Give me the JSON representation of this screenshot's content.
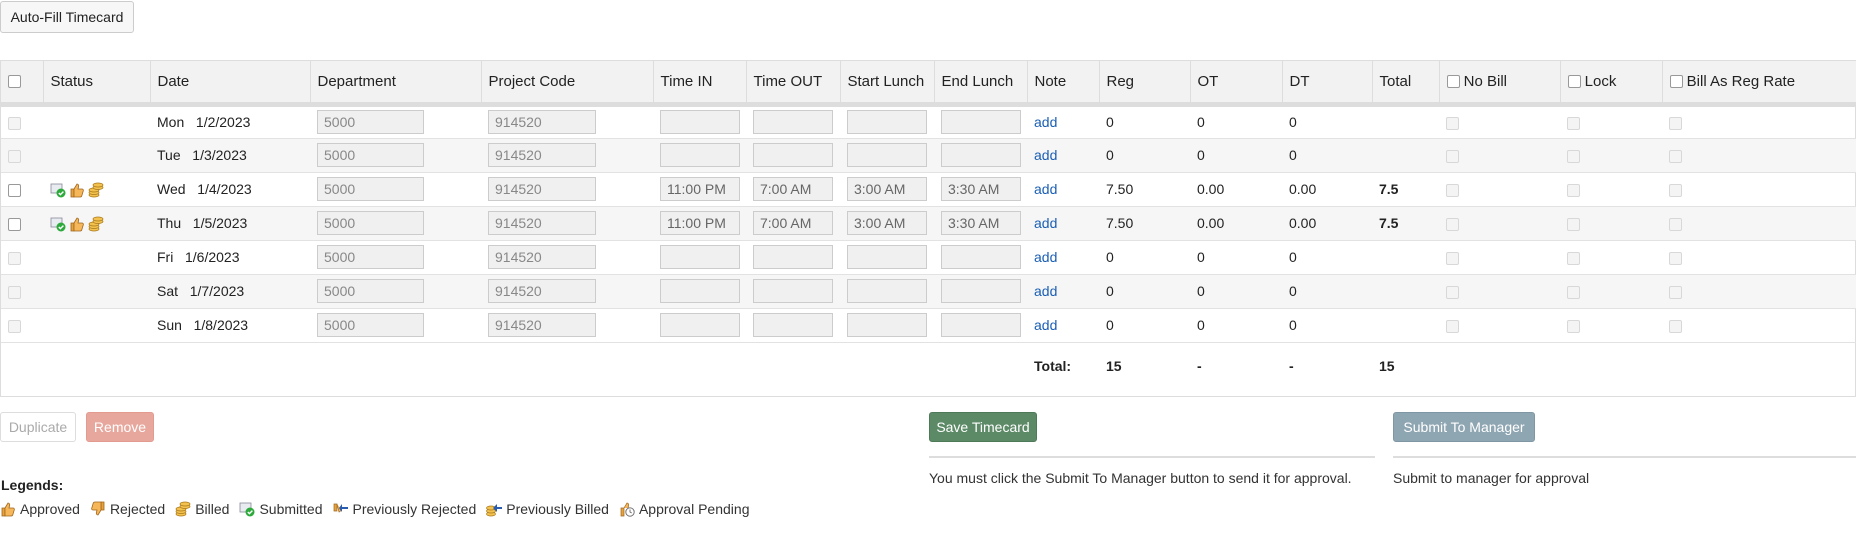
{
  "toolbar": {
    "autofill_label": "Auto-Fill Timecard"
  },
  "table": {
    "headers": {
      "status": "Status",
      "date": "Date",
      "department": "Department",
      "project_code": "Project Code",
      "time_in": "Time IN",
      "time_out": "Time OUT",
      "start_lunch": "Start Lunch",
      "end_lunch": "End Lunch",
      "note": "Note",
      "reg": "Reg",
      "ot": "OT",
      "dt": "DT",
      "total": "Total",
      "no_bill": "No Bill",
      "lock": "Lock",
      "bill_as_reg": "Bill As Reg Rate"
    },
    "rows": [
      {
        "day": "Mon",
        "date": "1/2/2023",
        "dept": "5000",
        "proj": "914520",
        "time_in": "",
        "time_out": "",
        "start_lunch": "",
        "end_lunch": "",
        "note": "add",
        "reg": "0",
        "ot": "0",
        "dt": "0",
        "total": "",
        "status": false
      },
      {
        "day": "Tue",
        "date": "1/3/2023",
        "dept": "5000",
        "proj": "914520",
        "time_in": "",
        "time_out": "",
        "start_lunch": "",
        "end_lunch": "",
        "note": "add",
        "reg": "0",
        "ot": "0",
        "dt": "0",
        "total": "",
        "status": false
      },
      {
        "day": "Wed",
        "date": "1/4/2023",
        "dept": "5000",
        "proj": "914520",
        "time_in": "11:00 PM",
        "time_out": "7:00 AM",
        "start_lunch": "3:00 AM",
        "end_lunch": "3:30 AM",
        "note": "add",
        "reg": "7.50",
        "ot": "0.00",
        "dt": "0.00",
        "total": "7.5",
        "status": true
      },
      {
        "day": "Thu",
        "date": "1/5/2023",
        "dept": "5000",
        "proj": "914520",
        "time_in": "11:00 PM",
        "time_out": "7:00 AM",
        "start_lunch": "3:00 AM",
        "end_lunch": "3:30 AM",
        "note": "add",
        "reg": "7.50",
        "ot": "0.00",
        "dt": "0.00",
        "total": "7.5",
        "status": true
      },
      {
        "day": "Fri",
        "date": "1/6/2023",
        "dept": "5000",
        "proj": "914520",
        "time_in": "",
        "time_out": "",
        "start_lunch": "",
        "end_lunch": "",
        "note": "add",
        "reg": "0",
        "ot": "0",
        "dt": "0",
        "total": "",
        "status": false
      },
      {
        "day": "Sat",
        "date": "1/7/2023",
        "dept": "5000",
        "proj": "914520",
        "time_in": "",
        "time_out": "",
        "start_lunch": "",
        "end_lunch": "",
        "note": "add",
        "reg": "0",
        "ot": "0",
        "dt": "0",
        "total": "",
        "status": false
      },
      {
        "day": "Sun",
        "date": "1/8/2023",
        "dept": "5000",
        "proj": "914520",
        "time_in": "",
        "time_out": "",
        "start_lunch": "",
        "end_lunch": "",
        "note": "add",
        "reg": "0",
        "ot": "0",
        "dt": "0",
        "total": "",
        "status": false
      }
    ],
    "totals": {
      "label": "Total:",
      "reg": "15",
      "ot": "-",
      "dt": "-",
      "total": "15"
    }
  },
  "actions": {
    "duplicate_label": "Duplicate",
    "remove_label": "Remove",
    "save_label": "Save Timecard",
    "submit_label": "Submit To Manager",
    "save_note": "You must click the Submit To Manager button to send it for approval.",
    "submit_note": "Submit to manager for approval"
  },
  "legend": {
    "title": "Legends:",
    "items": [
      {
        "icon": "thumbs-up-icon",
        "label": "Approved"
      },
      {
        "icon": "thumbs-down-icon",
        "label": "Rejected"
      },
      {
        "icon": "coins-icon",
        "label": "Billed"
      },
      {
        "icon": "submitted-check-icon",
        "label": "Submitted"
      },
      {
        "icon": "previously-rejected-icon",
        "label": "Previously Rejected"
      },
      {
        "icon": "previously-billed-icon",
        "label": "Previously Billed"
      },
      {
        "icon": "approval-pending-icon",
        "label": "Approval Pending"
      }
    ]
  },
  "colors": {
    "link": "#1a5fb4",
    "save": "#5c8a67",
    "remove": "#e8a79d",
    "submit": "#8ea5b2",
    "header_bg": "#f2f2f2"
  }
}
